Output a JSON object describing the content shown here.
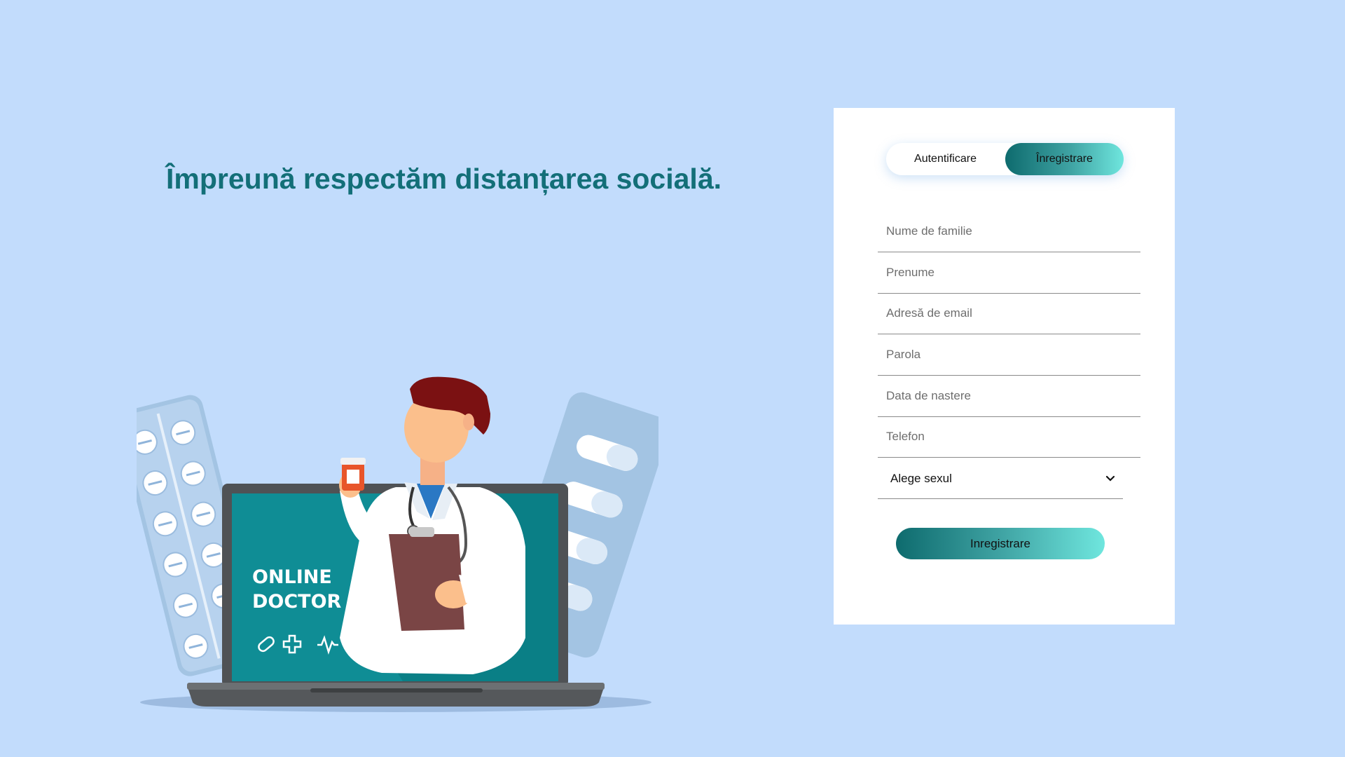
{
  "headline": "Împreună respectăm distanțarea socială.",
  "illustration": {
    "screen_line1": "ONLINE",
    "screen_line2": "DOCTOR"
  },
  "auth_toggle": {
    "login_label": "Autentificare",
    "register_label": "Înregistrare",
    "active": "register"
  },
  "form": {
    "fields": [
      {
        "placeholder": "Nume de familie",
        "value": ""
      },
      {
        "placeholder": "Prenume",
        "value": ""
      },
      {
        "placeholder": "Adresă de email",
        "value": ""
      },
      {
        "placeholder": "Parola",
        "value": ""
      },
      {
        "placeholder": "Data de nastere",
        "value": ""
      },
      {
        "placeholder": "Telefon",
        "value": ""
      }
    ],
    "gender_select": {
      "selected": "Alege sexul"
    },
    "submit_label": "Inregistrare"
  },
  "colors": {
    "background": "#c2dcfc",
    "heading": "#136f78",
    "gradient_start": "#0e6b6e",
    "gradient_end": "#6fe6de"
  }
}
